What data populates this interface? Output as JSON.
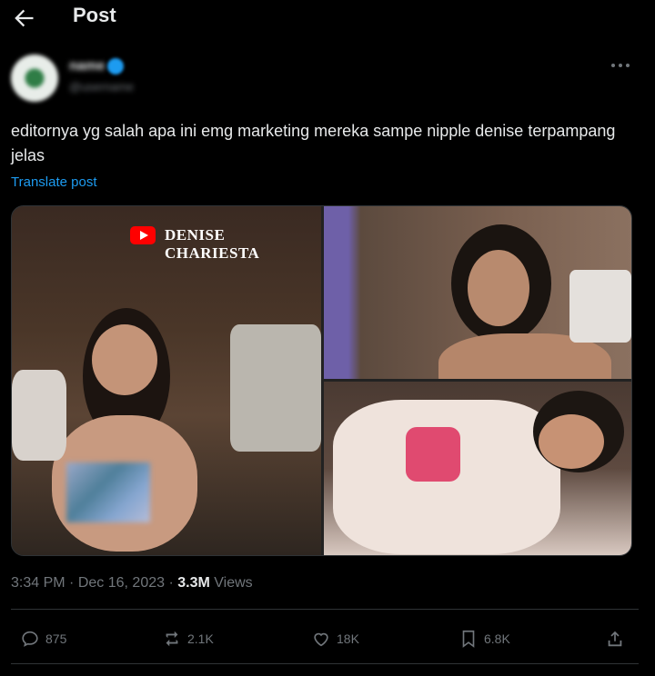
{
  "header": {
    "title": "Post"
  },
  "author": {
    "name": "name",
    "handle": "@username"
  },
  "post": {
    "text": "editornya yg salah apa ini emg marketing mereka sampe nipple denise terpampang jelas",
    "translate_label": "Translate post",
    "watermark": "DENISE CHARIESTA"
  },
  "meta": {
    "time": "3:34 PM",
    "separator1": "·",
    "date": "Dec 16, 2023",
    "separator2": "·",
    "views_count": "3.3M",
    "views_label": "Views"
  },
  "actions": {
    "replies": "875",
    "reposts": "2.1K",
    "likes": "18K",
    "bookmarks": "6.8K"
  },
  "colors": {
    "accent": "#1d9bf0",
    "muted": "#71767b",
    "text": "#e7e9ea",
    "background": "#000000"
  }
}
